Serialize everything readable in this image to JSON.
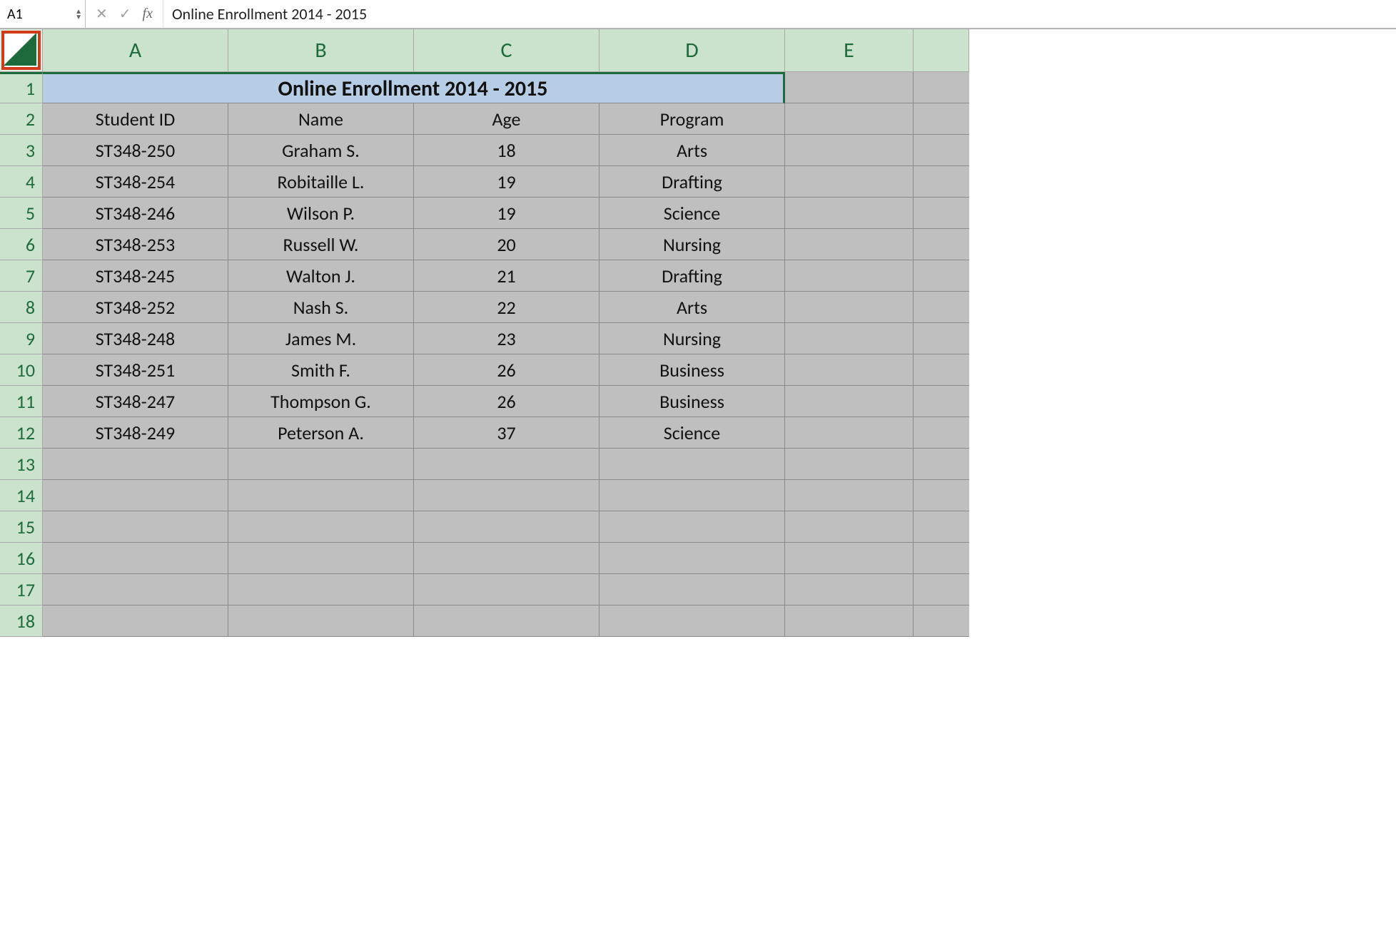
{
  "formula_bar": {
    "name_box": "A1",
    "formula_text": "Online Enrollment 2014 - 2015",
    "fx_label": "fx",
    "cancel_glyph": "✕",
    "enter_glyph": "✓",
    "spinner_up": "▲",
    "spinner_down": "▼"
  },
  "columns": [
    "A",
    "B",
    "C",
    "D",
    "E",
    ""
  ],
  "title_row": {
    "value": "Online Enrollment 2014 - 2015"
  },
  "header_row": [
    "Student ID",
    "Name",
    "Age",
    "Program"
  ],
  "data_rows": [
    [
      "ST348-250",
      "Graham S.",
      "18",
      "Arts"
    ],
    [
      "ST348-254",
      "Robitaille L.",
      "19",
      "Drafting"
    ],
    [
      "ST348-246",
      "Wilson P.",
      "19",
      "Science"
    ],
    [
      "ST348-253",
      "Russell W.",
      "20",
      "Nursing"
    ],
    [
      "ST348-245",
      "Walton J.",
      "21",
      "Drafting"
    ],
    [
      "ST348-252",
      "Nash S.",
      "22",
      "Arts"
    ],
    [
      "ST348-248",
      "James M.",
      "23",
      "Nursing"
    ],
    [
      "ST348-251",
      "Smith F.",
      "26",
      "Business"
    ],
    [
      "ST348-247",
      "Thompson G.",
      "26",
      "Business"
    ],
    [
      "ST348-249",
      "Peterson A.",
      "37",
      "Science"
    ]
  ],
  "row_numbers": [
    "1",
    "2",
    "3",
    "4",
    "5",
    "6",
    "7",
    "8",
    "9",
    "10",
    "11",
    "12",
    "13",
    "14",
    "15",
    "16",
    "17",
    "18"
  ]
}
